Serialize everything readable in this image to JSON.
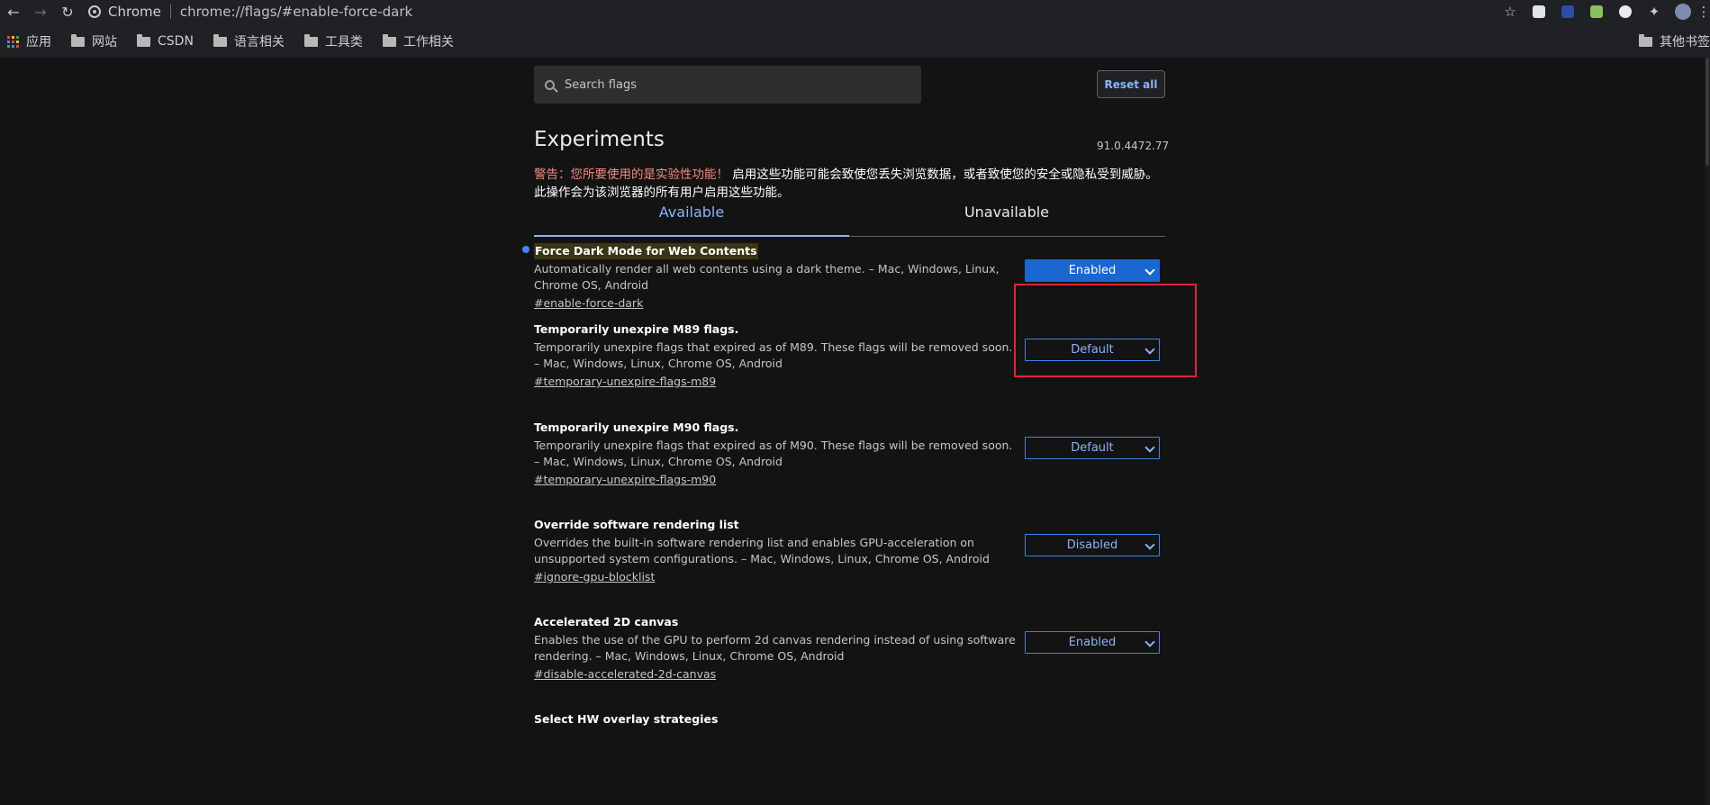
{
  "browser": {
    "tab_label": "Chrome",
    "url": "chrome://flags/#enable-force-dark",
    "back_icon": "←",
    "forward_icon": "→",
    "reload_icon": "↻",
    "star_icon": "☆",
    "extensions_icon": "✦",
    "menu_icon": "⋮"
  },
  "bookmarks": {
    "apps_label": "应用",
    "items": [
      "网站",
      "CSDN",
      "语言相关",
      "工具类",
      "工作相关"
    ],
    "other_label": "其他书签"
  },
  "flags_page": {
    "search_placeholder": "Search flags",
    "reset_label": "Reset all",
    "title": "Experiments",
    "version": "91.0.4472.77",
    "warning_prefix": "警告：您所要使用的是实验性功能！",
    "warning_text": "启用这些功能可能会致使您丢失浏览数据，或者致使您的安全或隐私受到威胁。此操作会为该浏览器的所有用户启用这些功能。",
    "tabs": [
      {
        "label": "Available"
      },
      {
        "label": "Unavailable"
      }
    ],
    "flags": [
      {
        "name": "Force Dark Mode for Web Contents",
        "desc": "Automatically render all web contents using a dark theme. – Mac, Windows, Linux, Chrome OS, Android",
        "link": "#enable-force-dark",
        "value": "Enabled"
      },
      {
        "name": "Temporarily unexpire M89 flags.",
        "desc": "Temporarily unexpire flags that expired as of M89. These flags will be removed soon. – Mac, Windows, Linux, Chrome OS, Android",
        "link": "#temporary-unexpire-flags-m89",
        "value": "Default"
      },
      {
        "name": "Temporarily unexpire M90 flags.",
        "desc": "Temporarily unexpire flags that expired as of M90. These flags will be removed soon. – Mac, Windows, Linux, Chrome OS, Android",
        "link": "#temporary-unexpire-flags-m90",
        "value": "Default"
      },
      {
        "name": "Override software rendering list",
        "desc": "Overrides the built-in software rendering list and enables GPU-acceleration on unsupported system configurations. – Mac, Windows, Linux, Chrome OS, Android",
        "link": "#ignore-gpu-blocklist",
        "value": "Disabled"
      },
      {
        "name": "Accelerated 2D canvas",
        "desc": "Enables the use of the GPU to perform 2d canvas rendering instead of using software rendering. – Mac, Windows, Linux, Chrome OS, Android",
        "link": "#disable-accelerated-2d-canvas",
        "value": "Enabled"
      },
      {
        "name": "Select HW overlay strategies",
        "desc": "",
        "link": "",
        "value": ""
      }
    ]
  },
  "colors": {
    "accent": "#8ab4f8",
    "enabled_bg": "#1a67d2",
    "highlight_box": "#e8213a"
  }
}
